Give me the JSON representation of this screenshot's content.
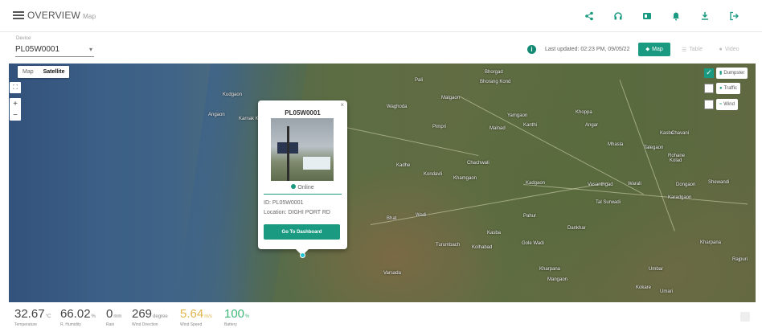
{
  "header": {
    "title": "OVERVIEW",
    "subtitle": "Map",
    "icons": [
      "share-icon",
      "headset-icon",
      "device-icon",
      "bell-icon",
      "download-icon",
      "logout-icon"
    ]
  },
  "controls": {
    "device_label": "Device",
    "device_value": "PL05W0001",
    "last_updated": "Last updated: 02:23 PM, 09/05/22",
    "view_map": "Map",
    "view_table": "Table",
    "view_video": "Video"
  },
  "map": {
    "toggle_map": "Map",
    "toggle_satellite": "Satellite",
    "zoom_in": "+",
    "zoom_out": "−",
    "layers": [
      {
        "label": "Dumpster",
        "checked": true
      },
      {
        "label": "Traffic",
        "checked": false
      },
      {
        "label": "Wind",
        "checked": false
      }
    ],
    "places": [
      "Pali",
      "Bhorgad",
      "Bhorang Kond",
      "Kudgaon",
      "Angaon",
      "Karnak Kot",
      "Malgaon",
      "Waghoda",
      "Malnad",
      "Pimpri",
      "Kanthi",
      "Angar",
      "Mhasla",
      "Kasbe",
      "Yamgaon",
      "Khoppa",
      "Kadhe",
      "Kondavli",
      "Khamgaon",
      "Chachwali",
      "Kadgaon",
      "Vasanthgad",
      "Warali",
      "Gole Wadi",
      "Dankhar",
      "Rohane",
      "Kolad",
      "Talegaon",
      "Chavani",
      "Tal Surwadi",
      "Karadgaon",
      "Turumbach",
      "Kolhabad",
      "Umbar",
      "Kharpana",
      "Dongaon",
      "Shewandi",
      "Mangaon",
      "Kokare",
      "Umari",
      "Pahur",
      "Bhat",
      "Wadi",
      "Varsada",
      "Kasba",
      "Kharpana",
      "Rajpuri"
    ]
  },
  "popup": {
    "title": "PL05W0001",
    "status": "Online",
    "id_line": "ID: PL05W0001",
    "location_line": "Location: DIGHI PORT RD",
    "button": "Go To Dashboard"
  },
  "stats": [
    {
      "value": "32.67",
      "unit": "°C",
      "label": "Temperature",
      "color": "#444444"
    },
    {
      "value": "66.02",
      "unit": "%",
      "label": "R. Humidity",
      "color": "#444444"
    },
    {
      "value": "0",
      "unit": "mm",
      "label": "Rain",
      "color": "#444444"
    },
    {
      "value": "269",
      "unit": "degree",
      "label": "Wind Direction",
      "color": "#444444"
    },
    {
      "value": "5.64",
      "unit": "m/s",
      "label": "Wind Speed",
      "color": "#e0b54a"
    },
    {
      "value": "100",
      "unit": "%",
      "label": "Battery",
      "color": "#3cb878"
    }
  ],
  "colors": {
    "accent": "#1a9a80",
    "online": "#1a9a80",
    "wind_speed": "#e0b54a",
    "battery": "#3cb878"
  }
}
